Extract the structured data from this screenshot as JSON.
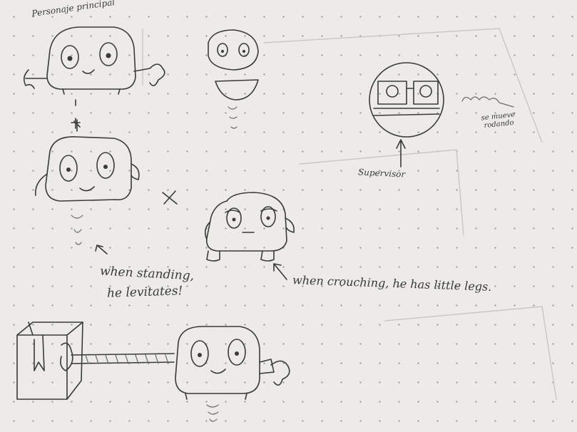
{
  "notes": {
    "main_character": "Personaje principal",
    "supervisor": "Supervisor",
    "supervisor_note": "se mueve rodando",
    "when_standing": "when standing,",
    "he_levitates": "he levitates!",
    "when_crouching": "when crouching, he has little legs."
  },
  "icons": {
    "robot_main": "robot-character-icon",
    "robot_small": "small-robot-icon",
    "supervisor": "supervisor-robot-icon",
    "box": "cardboard-box-icon"
  }
}
